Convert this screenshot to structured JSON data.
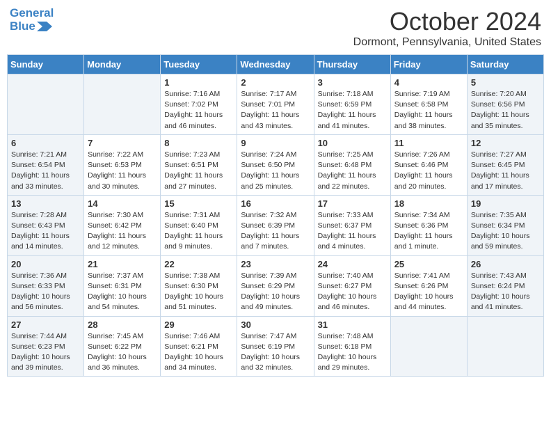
{
  "header": {
    "logo_line1": "General",
    "logo_line2": "Blue",
    "month_title": "October 2024",
    "location": "Dormont, Pennsylvania, United States"
  },
  "weekdays": [
    "Sunday",
    "Monday",
    "Tuesday",
    "Wednesday",
    "Thursday",
    "Friday",
    "Saturday"
  ],
  "weeks": [
    [
      {
        "day": "",
        "sunrise": "",
        "sunset": "",
        "daylight": "",
        "empty": true
      },
      {
        "day": "",
        "sunrise": "",
        "sunset": "",
        "daylight": "",
        "empty": true
      },
      {
        "day": "1",
        "sunrise": "Sunrise: 7:16 AM",
        "sunset": "Sunset: 7:02 PM",
        "daylight": "Daylight: 11 hours and 46 minutes."
      },
      {
        "day": "2",
        "sunrise": "Sunrise: 7:17 AM",
        "sunset": "Sunset: 7:01 PM",
        "daylight": "Daylight: 11 hours and 43 minutes."
      },
      {
        "day": "3",
        "sunrise": "Sunrise: 7:18 AM",
        "sunset": "Sunset: 6:59 PM",
        "daylight": "Daylight: 11 hours and 41 minutes."
      },
      {
        "day": "4",
        "sunrise": "Sunrise: 7:19 AM",
        "sunset": "Sunset: 6:58 PM",
        "daylight": "Daylight: 11 hours and 38 minutes."
      },
      {
        "day": "5",
        "sunrise": "Sunrise: 7:20 AM",
        "sunset": "Sunset: 6:56 PM",
        "daylight": "Daylight: 11 hours and 35 minutes.",
        "weekend": true
      }
    ],
    [
      {
        "day": "6",
        "sunrise": "Sunrise: 7:21 AM",
        "sunset": "Sunset: 6:54 PM",
        "daylight": "Daylight: 11 hours and 33 minutes.",
        "weekend": true
      },
      {
        "day": "7",
        "sunrise": "Sunrise: 7:22 AM",
        "sunset": "Sunset: 6:53 PM",
        "daylight": "Daylight: 11 hours and 30 minutes."
      },
      {
        "day": "8",
        "sunrise": "Sunrise: 7:23 AM",
        "sunset": "Sunset: 6:51 PM",
        "daylight": "Daylight: 11 hours and 27 minutes."
      },
      {
        "day": "9",
        "sunrise": "Sunrise: 7:24 AM",
        "sunset": "Sunset: 6:50 PM",
        "daylight": "Daylight: 11 hours and 25 minutes."
      },
      {
        "day": "10",
        "sunrise": "Sunrise: 7:25 AM",
        "sunset": "Sunset: 6:48 PM",
        "daylight": "Daylight: 11 hours and 22 minutes."
      },
      {
        "day": "11",
        "sunrise": "Sunrise: 7:26 AM",
        "sunset": "Sunset: 6:46 PM",
        "daylight": "Daylight: 11 hours and 20 minutes."
      },
      {
        "day": "12",
        "sunrise": "Sunrise: 7:27 AM",
        "sunset": "Sunset: 6:45 PM",
        "daylight": "Daylight: 11 hours and 17 minutes.",
        "weekend": true
      }
    ],
    [
      {
        "day": "13",
        "sunrise": "Sunrise: 7:28 AM",
        "sunset": "Sunset: 6:43 PM",
        "daylight": "Daylight: 11 hours and 14 minutes.",
        "weekend": true
      },
      {
        "day": "14",
        "sunrise": "Sunrise: 7:30 AM",
        "sunset": "Sunset: 6:42 PM",
        "daylight": "Daylight: 11 hours and 12 minutes."
      },
      {
        "day": "15",
        "sunrise": "Sunrise: 7:31 AM",
        "sunset": "Sunset: 6:40 PM",
        "daylight": "Daylight: 11 hours and 9 minutes."
      },
      {
        "day": "16",
        "sunrise": "Sunrise: 7:32 AM",
        "sunset": "Sunset: 6:39 PM",
        "daylight": "Daylight: 11 hours and 7 minutes."
      },
      {
        "day": "17",
        "sunrise": "Sunrise: 7:33 AM",
        "sunset": "Sunset: 6:37 PM",
        "daylight": "Daylight: 11 hours and 4 minutes."
      },
      {
        "day": "18",
        "sunrise": "Sunrise: 7:34 AM",
        "sunset": "Sunset: 6:36 PM",
        "daylight": "Daylight: 11 hours and 1 minute."
      },
      {
        "day": "19",
        "sunrise": "Sunrise: 7:35 AM",
        "sunset": "Sunset: 6:34 PM",
        "daylight": "Daylight: 10 hours and 59 minutes.",
        "weekend": true
      }
    ],
    [
      {
        "day": "20",
        "sunrise": "Sunrise: 7:36 AM",
        "sunset": "Sunset: 6:33 PM",
        "daylight": "Daylight: 10 hours and 56 minutes.",
        "weekend": true
      },
      {
        "day": "21",
        "sunrise": "Sunrise: 7:37 AM",
        "sunset": "Sunset: 6:31 PM",
        "daylight": "Daylight: 10 hours and 54 minutes."
      },
      {
        "day": "22",
        "sunrise": "Sunrise: 7:38 AM",
        "sunset": "Sunset: 6:30 PM",
        "daylight": "Daylight: 10 hours and 51 minutes."
      },
      {
        "day": "23",
        "sunrise": "Sunrise: 7:39 AM",
        "sunset": "Sunset: 6:29 PM",
        "daylight": "Daylight: 10 hours and 49 minutes."
      },
      {
        "day": "24",
        "sunrise": "Sunrise: 7:40 AM",
        "sunset": "Sunset: 6:27 PM",
        "daylight": "Daylight: 10 hours and 46 minutes."
      },
      {
        "day": "25",
        "sunrise": "Sunrise: 7:41 AM",
        "sunset": "Sunset: 6:26 PM",
        "daylight": "Daylight: 10 hours and 44 minutes."
      },
      {
        "day": "26",
        "sunrise": "Sunrise: 7:43 AM",
        "sunset": "Sunset: 6:24 PM",
        "daylight": "Daylight: 10 hours and 41 minutes.",
        "weekend": true
      }
    ],
    [
      {
        "day": "27",
        "sunrise": "Sunrise: 7:44 AM",
        "sunset": "Sunset: 6:23 PM",
        "daylight": "Daylight: 10 hours and 39 minutes.",
        "weekend": true
      },
      {
        "day": "28",
        "sunrise": "Sunrise: 7:45 AM",
        "sunset": "Sunset: 6:22 PM",
        "daylight": "Daylight: 10 hours and 36 minutes."
      },
      {
        "day": "29",
        "sunrise": "Sunrise: 7:46 AM",
        "sunset": "Sunset: 6:21 PM",
        "daylight": "Daylight: 10 hours and 34 minutes."
      },
      {
        "day": "30",
        "sunrise": "Sunrise: 7:47 AM",
        "sunset": "Sunset: 6:19 PM",
        "daylight": "Daylight: 10 hours and 32 minutes."
      },
      {
        "day": "31",
        "sunrise": "Sunrise: 7:48 AM",
        "sunset": "Sunset: 6:18 PM",
        "daylight": "Daylight: 10 hours and 29 minutes."
      },
      {
        "day": "",
        "sunrise": "",
        "sunset": "",
        "daylight": "",
        "empty": true
      },
      {
        "day": "",
        "sunrise": "",
        "sunset": "",
        "daylight": "",
        "empty": true
      }
    ]
  ]
}
